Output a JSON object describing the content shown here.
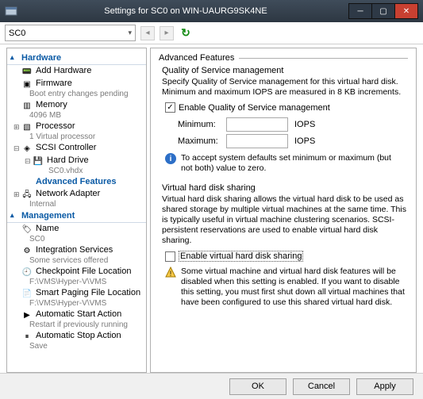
{
  "window": {
    "title": "Settings for SC0 on WIN-UAURG9SK4NE"
  },
  "toolbar": {
    "vm_name": "SC0"
  },
  "tree": {
    "cat_hw": "Hardware",
    "add_hw": "Add Hardware",
    "firmware": "Firmware",
    "firmware_sub": "Boot entry changes pending",
    "memory": "Memory",
    "memory_sub": "4096 MB",
    "processor": "Processor",
    "processor_sub": "1 Virtual processor",
    "scsi": "SCSI Controller",
    "hdd": "Hard Drive",
    "hdd_sub": "SC0.vhdx",
    "adv": "Advanced Features",
    "net": "Network Adapter",
    "net_sub": "Internal",
    "cat_mgmt": "Management",
    "name": "Name",
    "name_sub": "SC0",
    "integ": "Integration Services",
    "integ_sub": "Some services offered",
    "chk": "Checkpoint File Location",
    "chk_sub": "F:\\VMS\\Hyper-V\\VMS",
    "smart": "Smart Paging File Location",
    "smart_sub": "F:\\VMS\\Hyper-V\\VMS",
    "astart": "Automatic Start Action",
    "astart_sub": "Restart if previously running",
    "astop": "Automatic Stop Action",
    "astop_sub": "Save"
  },
  "detail": {
    "title": "Advanced Features",
    "qos_head": "Quality of Service management",
    "qos_desc": "Specify Quality of Service management for this virtual hard disk. Minimum and maximum IOPS are measured in 8 KB increments.",
    "qos_enable": "Enable Quality of Service management",
    "min_label": "Minimum:",
    "min_val": "",
    "iops": "IOPS",
    "max_label": "Maximum:",
    "max_val": "",
    "qos_info": "To accept system defaults set minimum or maximum (but not both) value to zero.",
    "vhd_head": "Virtual hard disk sharing",
    "vhd_desc": "Virtual hard disk sharing allows the virtual hard disk to be used as shared storage by multiple virtual machines at the same time. This is typically useful in virtual machine clustering scenarios. SCSI-persistent reservations are used to enable virtual hard disk sharing.",
    "vhd_enable": "Enable virtual hard disk sharing",
    "vhd_warn": "Some virtual machine and virtual hard disk features will be disabled when this setting is enabled. If you want to disable this setting, you must first shut down all virtual machines that have been configured to use this shared virtual hard disk."
  },
  "buttons": {
    "ok": "OK",
    "cancel": "Cancel",
    "apply": "Apply"
  }
}
